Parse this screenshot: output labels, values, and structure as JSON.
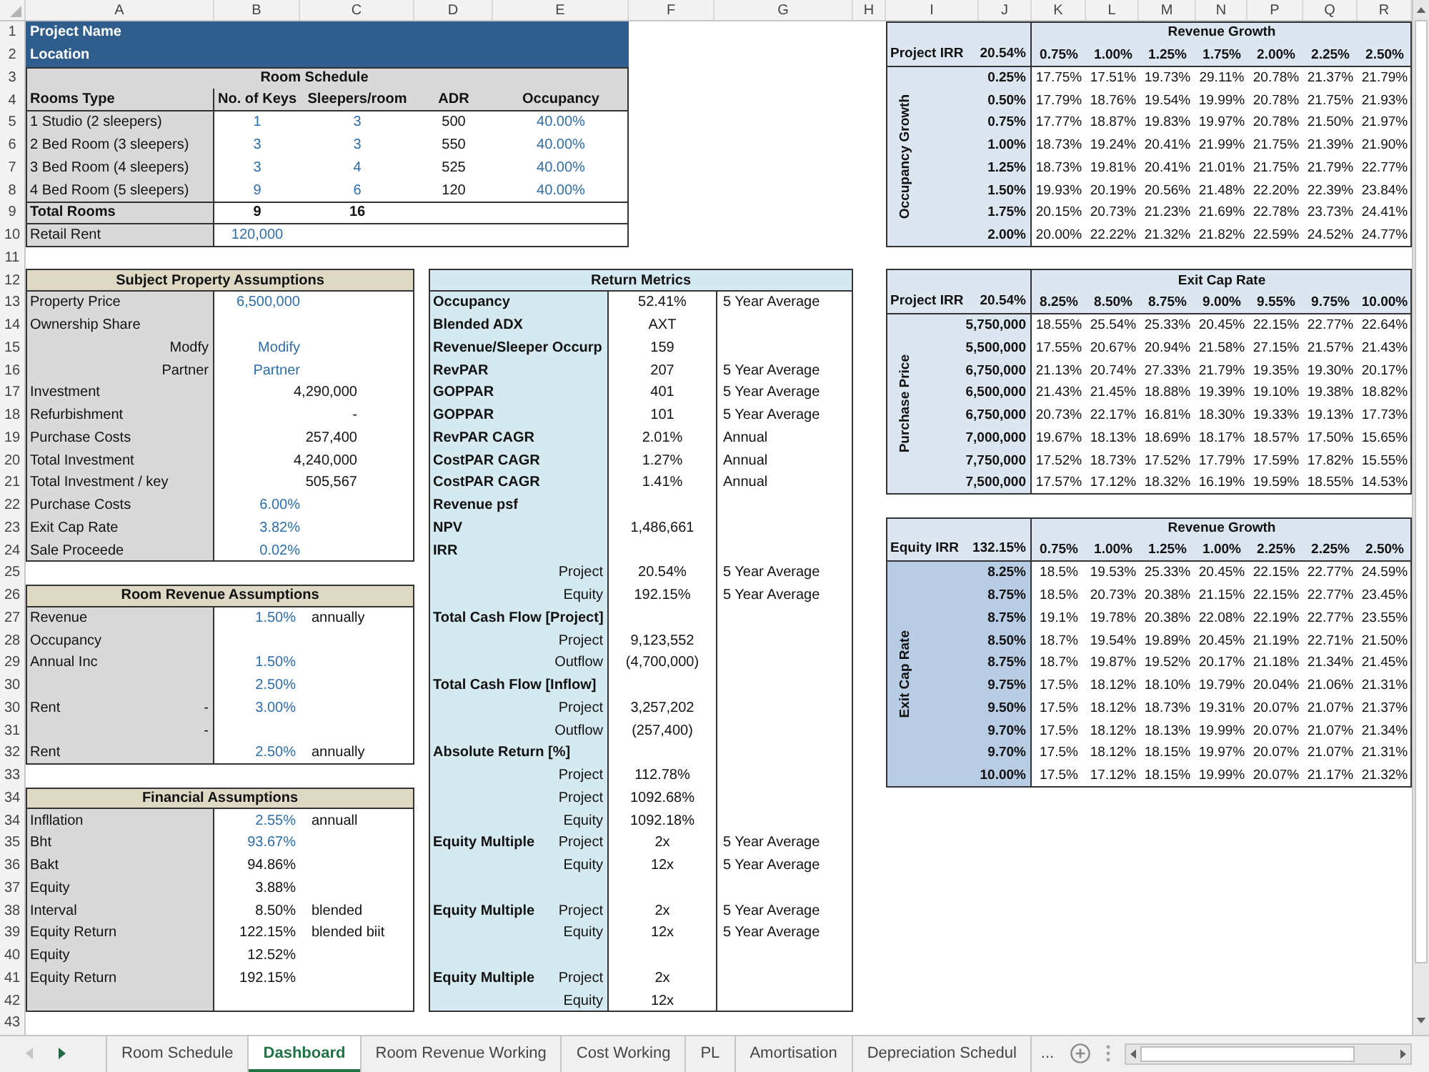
{
  "column_headers": [
    "A",
    "B",
    "C",
    "D",
    "E",
    "F",
    "G",
    "H",
    "I",
    "J",
    "K",
    "L",
    "M",
    "N",
    "P",
    "Q",
    "R"
  ],
  "row_numbers": [
    "1",
    "2",
    "3",
    "4",
    "5",
    "6",
    "7",
    "8",
    "9",
    "10",
    "11",
    "12",
    "13",
    "14",
    "15",
    "16",
    "17",
    "18",
    "19",
    "20",
    "21",
    "22",
    "23",
    "24",
    "25",
    "26",
    "27",
    "28",
    "29",
    "30",
    "30",
    "31",
    "32",
    "33",
    "34",
    "34",
    "35",
    "36",
    "37",
    "38",
    "39",
    "40",
    "41",
    "42",
    "43"
  ],
  "title_banner": [
    "Project Name",
    "Location"
  ],
  "room_schedule": {
    "title": "Room Schedule",
    "columns": [
      {
        "label": "Rooms Type",
        "input": false
      },
      {
        "label": "No. of Keys",
        "input": true
      },
      {
        "label": "Sleepers/room",
        "input": true
      },
      {
        "label": "ADR",
        "input": false
      },
      {
        "label": "Occupancy",
        "input": true
      }
    ],
    "rows": [
      [
        "1 Studio (2 sleepers)",
        "1",
        "3",
        "500",
        "40.00%"
      ],
      [
        "2 Bed Room (3 sleepers)",
        "3",
        "3",
        "550",
        "40.00%"
      ],
      [
        "3 Bed Room (4 sleepers)",
        "3",
        "4",
        "525",
        "40.00%"
      ],
      [
        "4 Bed Room (5 sleepers)",
        "9",
        "6",
        "120",
        "40.00%"
      ]
    ],
    "total": {
      "label": "Total Rooms",
      "values": [
        "9",
        "16"
      ]
    },
    "retail_rent": {
      "label": "Retail Rent",
      "value": "120,000",
      "input": true
    }
  },
  "assumption_tables": [
    {
      "title": "Subject Property Assumptions",
      "rows": [
        {
          "label": "Property Price",
          "value": "6,500,000",
          "input": true
        },
        {
          "label": "Ownership Share"
        },
        {
          "sublabel": "Modfy",
          "value": "Modify",
          "input": true
        },
        {
          "sublabel": "Partner",
          "value": "Partner",
          "input": true
        },
        {
          "label": "Investment",
          "value": "4,290,000",
          "input": false
        },
        {
          "label": "Refurbishment",
          "value": "-",
          "input": false
        },
        {
          "label": "Purchase Costs",
          "value": "257,400",
          "input": false
        },
        {
          "label": "Total Investment",
          "value": "4,240,000",
          "input": false
        },
        {
          "label": "Total Investment / key",
          "value": "505,567",
          "input": false
        },
        {
          "label": "Purchase Costs",
          "value": "6.00%",
          "input": true
        },
        {
          "label": "Exit Cap Rate",
          "value": "3.82%",
          "input": true
        },
        {
          "label": "Sale Proceede",
          "value": "0.02%",
          "input": true
        }
      ]
    },
    {
      "title": "Room Revenue Assumptions",
      "rows": [
        {
          "label": "Revenue",
          "value": "1.50%",
          "input": true,
          "note": "annually"
        },
        {
          "label": "Occupancy"
        },
        {
          "label": "Annual Inc",
          "value": "1.50%",
          "input": true
        },
        {
          "value": "2.50%",
          "input": true
        },
        {
          "label": "Rent",
          "sublabel": "-",
          "value": "3.00%",
          "input": true
        },
        {
          "sublabel": "-"
        },
        {
          "label": "Rent",
          "value": "2.50%",
          "input": true,
          "note": "annually"
        }
      ]
    },
    {
      "title": "Financial Assumptions",
      "rows": [
        {
          "label": "Infllation",
          "value": "2.55%",
          "input": true,
          "note": "annuall"
        },
        {
          "label": "Bht",
          "value": "93.67%",
          "input": true
        },
        {
          "label": "Bakt",
          "value": "94.86%",
          "input": false
        },
        {
          "label": "Equity",
          "value": "3.88%",
          "input": false
        },
        {
          "label": "Interval",
          "value": "8.50%",
          "input": false,
          "note": "blended"
        },
        {
          "label": "Equity Return",
          "value": "122.15%",
          "input": false,
          "note": "blended biit"
        },
        {
          "label": "Equity",
          "value": "12.52%",
          "input": false
        },
        {
          "label": "Equity Return",
          "value": "192.15%",
          "input": false
        },
        {}
      ]
    }
  ],
  "return_metrics": {
    "title": "Return Metrics",
    "rows": [
      {
        "label": "Occupancy",
        "value": "52.41%",
        "note": "5 Year Average"
      },
      {
        "label": "Blended ADX",
        "value": "AXT"
      },
      {
        "label": "Revenue/Sleeper Occurp",
        "value": "159"
      },
      {
        "label": "RevPAR",
        "value": "207",
        "note": "5 Year Average"
      },
      {
        "label": "GOPPAR",
        "value": "401",
        "note": "5 Year Average"
      },
      {
        "label": "GOPPAR",
        "value": "101",
        "note": "5 Year Average"
      },
      {
        "label": "RevPAR CAGR",
        "value": "2.01%",
        "note": "Annual"
      },
      {
        "label": "CostPAR CAGR",
        "value": "1.27%",
        "note": "Annual"
      },
      {
        "label": "CostPAR CAGR",
        "value": "1.41%",
        "note": "Annual"
      },
      {
        "label": "Revenue psf"
      },
      {
        "label": "NPV",
        "value": "1,486,661"
      },
      {
        "label": "IRR"
      },
      {
        "sublabel": "Project",
        "value": "20.54%",
        "note": "5 Year Average"
      },
      {
        "sublabel": "Equity",
        "value": "192.15%",
        "note": "5 Year Average"
      },
      {
        "label": "Total Cash Flow [Project]"
      },
      {
        "sublabel": "Project",
        "value": "9,123,552"
      },
      {
        "sublabel": "Outflow",
        "value": "(4,700,000)"
      },
      {
        "label": "Total Cash Flow [Inflow]"
      },
      {
        "sublabel": "Project",
        "value": "3,257,202"
      },
      {
        "sublabel": "Outflow",
        "value": "(257,400)"
      },
      {
        "label": "Absolute Return [%]"
      },
      {
        "sublabel": "Project",
        "value": "112.78%"
      },
      {
        "sublabel": "Project",
        "value": "1092.68%"
      },
      {
        "sublabel": "Equity",
        "value": "1092.18%"
      },
      {
        "label": "Equity Multiple",
        "sublabel": "Project",
        "value": "2x",
        "note": "5 Year Average"
      },
      {
        "sublabel": "Equity",
        "value": "12x",
        "note": "5 Year Average"
      },
      {},
      {
        "label": "Equity Multiple",
        "sublabel": "Project",
        "value": "2x",
        "note": "5 Year Average"
      },
      {
        "sublabel": "Equity",
        "value": "12x",
        "note": "5 Year Average"
      },
      {},
      {
        "label": "Equity Multiple",
        "sublabel": "Project",
        "value": "2x"
      },
      {
        "sublabel": "Equity",
        "value": "12x"
      }
    ]
  },
  "sensitivity_tables": [
    {
      "corner_label": "Project IRR",
      "corner_value": "20.54%",
      "column_title": "Revenue Growth",
      "row_title": "Occupancy Growth",
      "color": "#dce6f1",
      "columns": [
        "0.75%",
        "1.00%",
        "1.25%",
        "1.75%",
        "2.00%",
        "2.25%",
        "2.50%"
      ],
      "rows": [
        {
          "label": "0.25%",
          "values": [
            "17.75%",
            "17.51%",
            "19.73%",
            "29.11%",
            "20.78%",
            "21.37%",
            "21.79%"
          ]
        },
        {
          "label": "0.50%",
          "values": [
            "17.79%",
            "18.76%",
            "19.54%",
            "19.99%",
            "20.78%",
            "21.75%",
            "21.93%"
          ]
        },
        {
          "label": "0.75%",
          "values": [
            "17.77%",
            "18.87%",
            "19.83%",
            "19.97%",
            "20.78%",
            "21.50%",
            "21.97%"
          ]
        },
        {
          "label": "1.00%",
          "values": [
            "18.73%",
            "19.24%",
            "20.41%",
            "21.99%",
            "21.75%",
            "21.39%",
            "21.90%"
          ]
        },
        {
          "label": "1.25%",
          "values": [
            "18.73%",
            "19.81%",
            "20.41%",
            "21.01%",
            "21.75%",
            "21.79%",
            "22.77%"
          ]
        },
        {
          "label": "1.50%",
          "values": [
            "19.93%",
            "20.19%",
            "20.56%",
            "21.48%",
            "22.20%",
            "22.39%",
            "23.84%"
          ]
        },
        {
          "label": "1.75%",
          "values": [
            "20.15%",
            "20.73%",
            "21.23%",
            "21.69%",
            "22.78%",
            "23.73%",
            "24.41%"
          ]
        },
        {
          "label": "2.00%",
          "values": [
            "20.00%",
            "22.22%",
            "21.32%",
            "21.82%",
            "22.59%",
            "24.52%",
            "24.77%"
          ]
        }
      ]
    },
    {
      "corner_label": "Project IRR",
      "corner_value": "20.54%",
      "column_title": "Exit Cap Rate",
      "row_title": "Purchase Price",
      "color": "#dce6f1",
      "columns": [
        "8.25%",
        "8.50%",
        "8.75%",
        "9.00%",
        "9.55%",
        "9.75%",
        "10.00%"
      ],
      "rows": [
        {
          "label": "5,750,000",
          "values": [
            "18.55%",
            "25.54%",
            "25.33%",
            "20.45%",
            "22.15%",
            "22.77%",
            "22.64%"
          ]
        },
        {
          "label": "5,500,000",
          "values": [
            "17.55%",
            "20.67%",
            "20.94%",
            "21.58%",
            "27.15%",
            "21.57%",
            "21.43%"
          ]
        },
        {
          "label": "6,750,000",
          "values": [
            "21.13%",
            "20.74%",
            "27.33%",
            "21.79%",
            "19.35%",
            "19.30%",
            "20.17%"
          ]
        },
        {
          "label": "6,500,000",
          "values": [
            "21.43%",
            "21.45%",
            "18.88%",
            "19.39%",
            "19.10%",
            "19.38%",
            "18.82%"
          ]
        },
        {
          "label": "6,750,000",
          "values": [
            "20.73%",
            "22.17%",
            "16.81%",
            "18.30%",
            "19.33%",
            "19.13%",
            "17.73%"
          ]
        },
        {
          "label": "7,000,000",
          "values": [
            "19.67%",
            "18.13%",
            "18.69%",
            "18.17%",
            "18.57%",
            "17.50%",
            "15.65%"
          ]
        },
        {
          "label": "7,750,000",
          "values": [
            "17.52%",
            "18.73%",
            "17.52%",
            "17.79%",
            "17.59%",
            "17.82%",
            "15.55%"
          ]
        },
        {
          "label": "7,500,000",
          "values": [
            "17.57%",
            "17.12%",
            "18.32%",
            "16.19%",
            "19.59%",
            "18.55%",
            "14.53%"
          ]
        }
      ]
    },
    {
      "corner_label": "Equity IRR",
      "corner_value": "132.15%",
      "column_title": "Revenue Growth",
      "row_title": "Exit Cap Rate",
      "color": "#b8cce4",
      "columns": [
        "0.75%",
        "1.00%",
        "1.25%",
        "1.00%",
        "2.25%",
        "2.25%",
        "2.50%"
      ],
      "rows": [
        {
          "label": "8.25%",
          "values": [
            "18.5%",
            "19.53%",
            "25.33%",
            "20.45%",
            "22.15%",
            "22.77%",
            "24.59%"
          ]
        },
        {
          "label": "8.75%",
          "values": [
            "18.5%",
            "20.73%",
            "20.38%",
            "21.15%",
            "22.15%",
            "22.77%",
            "23.45%"
          ]
        },
        {
          "label": "8.75%",
          "values": [
            "19.1%",
            "19.78%",
            "20.38%",
            "22.08%",
            "22.19%",
            "22.77%",
            "23.55%"
          ]
        },
        {
          "label": "8.50%",
          "values": [
            "18.7%",
            "19.54%",
            "19.89%",
            "20.45%",
            "21.19%",
            "22.71%",
            "21.50%"
          ]
        },
        {
          "label": "8.75%",
          "values": [
            "18.7%",
            "19.87%",
            "19.52%",
            "20.17%",
            "21.18%",
            "21.34%",
            "21.45%"
          ]
        },
        {
          "label": "9.75%",
          "values": [
            "17.5%",
            "18.12%",
            "18.10%",
            "19.79%",
            "20.04%",
            "21.06%",
            "21.31%"
          ]
        },
        {
          "label": "9.50%",
          "values": [
            "17.5%",
            "18.12%",
            "18.73%",
            "19.31%",
            "20.07%",
            "21.07%",
            "21.37%"
          ]
        },
        {
          "label": "9.70%",
          "values": [
            "17.5%",
            "18.12%",
            "18.13%",
            "19.99%",
            "20.07%",
            "21.07%",
            "21.34%"
          ]
        },
        {
          "label": "9.70%",
          "values": [
            "17.5%",
            "18.12%",
            "18.15%",
            "19.97%",
            "20.07%",
            "21.07%",
            "21.31%"
          ]
        },
        {
          "label": "10.00%",
          "values": [
            "17.5%",
            "17.12%",
            "18.15%",
            "19.99%",
            "20.07%",
            "21.17%",
            "21.32%"
          ]
        }
      ]
    }
  ],
  "sheet_tab_nav": [
    {
      "disabled": true
    },
    {
      "disabled": false
    }
  ],
  "sheet_tabs": [
    {
      "label": "Room Schedule",
      "selected": false
    },
    {
      "label": "Dashboard",
      "selected": true
    },
    {
      "label": "Room Revenue Working",
      "selected": false
    },
    {
      "label": "Cost Working",
      "selected": false
    },
    {
      "label": "PL",
      "selected": false
    },
    {
      "label": "Amortisation",
      "selected": false
    },
    {
      "label": "Depreciation Schedul",
      "selected": false
    }
  ],
  "more_tabs": "..."
}
